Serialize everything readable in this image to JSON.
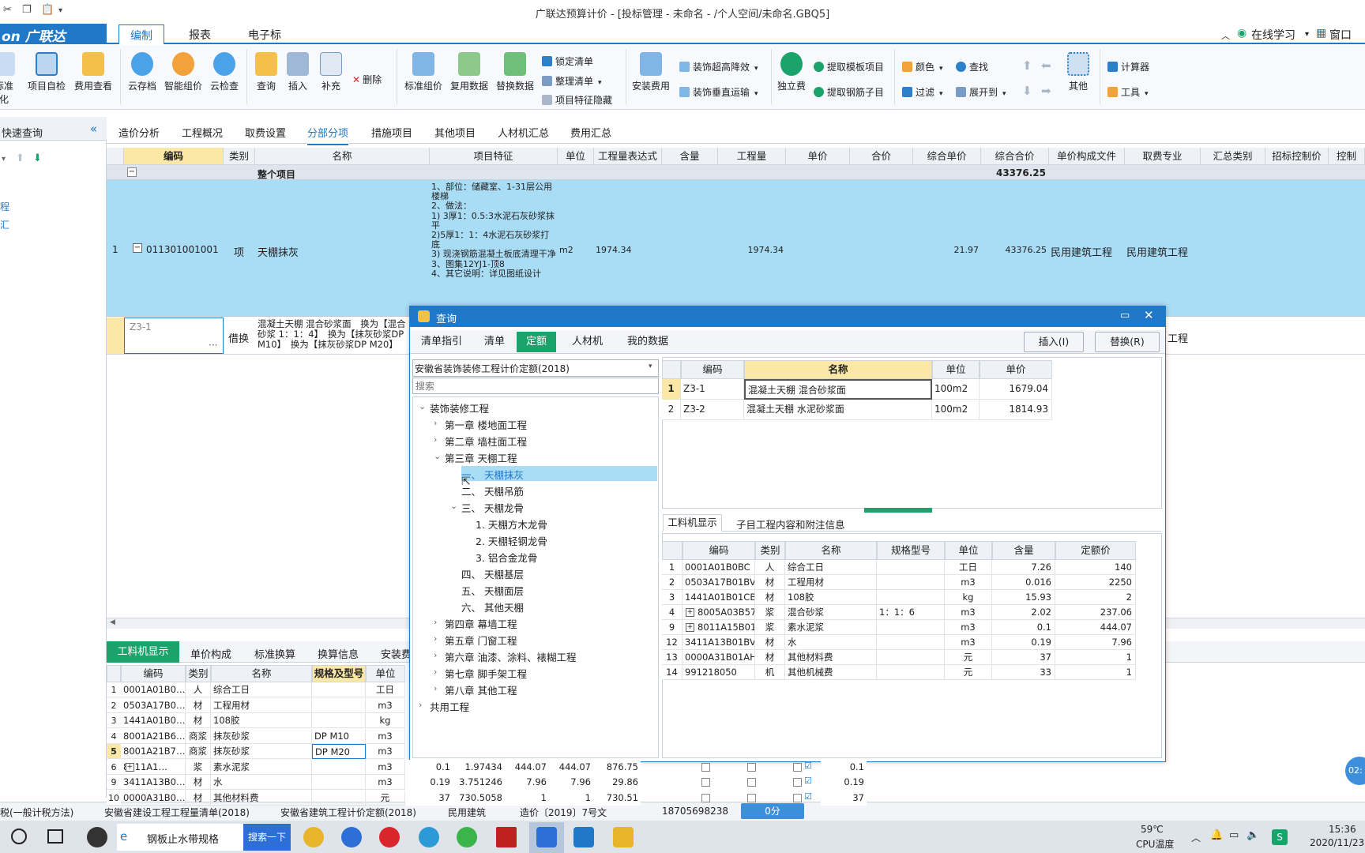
{
  "window_title": "广联达预算计价 - [投标管理 - 未命名 - /个人空间/未命名.GBQ5]",
  "logo_text": "on 广联达",
  "menu": {
    "tabs": [
      "编制",
      "报表",
      "电子标"
    ],
    "right": [
      "在线学习",
      "窗口"
    ]
  },
  "ribbon": {
    "big_buttons": [
      "标准化",
      "项目自检",
      "费用查看",
      "云存档",
      "智能组价",
      "云检查",
      "查询",
      "插入",
      "补充",
      "标准组价",
      "复用数据",
      "替换数据",
      "安装费用",
      "独立费",
      "其他"
    ],
    "small_buttons": [
      "删除",
      "锁定清单",
      "整理清单",
      "项目特征隐藏",
      "装饰超高降效",
      "装饰垂直运输",
      "提取模板项目",
      "提取钢筋子目",
      "颜色",
      "查找",
      "过滤",
      "展开到",
      "计算器",
      "工具"
    ]
  },
  "left_panel": {
    "title": "快速查询",
    "items": [
      "程",
      "汇"
    ]
  },
  "view_tabs": [
    "造价分析",
    "工程概况",
    "取费设置",
    "分部分项",
    "措施项目",
    "其他项目",
    "人材机汇总",
    "费用汇总"
  ],
  "grid": {
    "headers": [
      "编码",
      "类别",
      "名称",
      "项目特征",
      "单位",
      "工程量表达式",
      "含量",
      "工程量",
      "单价",
      "合价",
      "综合单价",
      "综合合价",
      "单价构成文件",
      "取费专业",
      "汇总类别",
      "招标控制价",
      "控制"
    ],
    "total_row": {
      "label": "整个项目",
      "amount": "43376.25"
    },
    "row1": {
      "index": "1",
      "code": "011301001001",
      "type": "项",
      "name": "天棚抹灰",
      "feature": "1、部位：储藏室、1-31层公用楼梯\n2、做法：\n1) 3厚1：0.5:3水泥石灰砂浆抹平\n2)5厚1：1：4水泥石灰砂浆打底\n3) 现浇钢筋混凝土板底清理干净\n3、图集12YJ1-顶8\n4、其它说明：详见图纸设计",
      "unit": "m2",
      "qty_expr": "1974.34",
      "qty": "1974.34",
      "unit_price": "21.97",
      "total": "43376.25",
      "price_file": "民用建筑工程",
      "fee_major": "民用建筑工程"
    },
    "row2": {
      "code": "Z3-1",
      "type": "借换",
      "name": "混凝土天棚 混合砂浆面　换为【混合砂浆 1：1：4】　换为【抹灰砂浆DP M10】　换为【抹灰砂浆DP M20】",
      "fee_major_partial": "工程"
    }
  },
  "bottom_panel": {
    "tabs": [
      "工料机显示",
      "单价构成",
      "标准换算",
      "换算信息",
      "安装费"
    ],
    "headers": [
      "编码",
      "类别",
      "名称",
      "规格及型号",
      "单位"
    ],
    "rows": [
      {
        "i": "1",
        "code": "0001A01B0…",
        "type": "人",
        "name": "综合工日",
        "spec": "",
        "unit": "工日",
        "extra": []
      },
      {
        "i": "2",
        "code": "0503A17B0…",
        "type": "材",
        "name": "工程用材",
        "spec": "",
        "unit": "m3",
        "extra": []
      },
      {
        "i": "3",
        "code": "1441A01B0…",
        "type": "材",
        "name": "108胶",
        "spec": "",
        "unit": "kg",
        "extra": []
      },
      {
        "i": "4",
        "code": "8001A21B6…",
        "type": "商浆",
        "name": "抹灰砂浆",
        "spec": "DP M10",
        "unit": "m3",
        "extra": []
      },
      {
        "i": "5",
        "code": "8001A21B7…",
        "type": "商浆",
        "name": "抹灰砂浆",
        "spec": "DP M20",
        "unit": "m3",
        "extra": []
      },
      {
        "i": "6",
        "code": "8011A1…",
        "type": "浆",
        "name": "素水泥浆",
        "spec": "",
        "unit": "m3",
        "extra": [
          "0.1",
          "1.97434",
          "444.07",
          "444.07",
          "876.75",
          "0.1"
        ]
      },
      {
        "i": "9",
        "code": "3411A13B0…",
        "type": "材",
        "name": "水",
        "spec": "",
        "unit": "m3",
        "extra": [
          "0.19",
          "3.751246",
          "7.96",
          "7.96",
          "29.86",
          "0.19"
        ]
      },
      {
        "i": "10",
        "code": "0000A31B0…",
        "type": "材",
        "name": "其他材料费",
        "spec": "",
        "unit": "元",
        "extra": [
          "37",
          "730.5058",
          "1",
          "1",
          "730.51",
          "37"
        ]
      }
    ]
  },
  "dialog": {
    "title": "查询",
    "tabs": [
      "清单指引",
      "清单",
      "定额",
      "人材机",
      "我的数据"
    ],
    "buttons": [
      "插入(I)",
      "替换(R)"
    ],
    "library": "安徽省装饰装修工程计价定额(2018)",
    "search_placeholder": "搜索",
    "tree": [
      {
        "label": "装饰装修工程",
        "level": 0,
        "arrow": "down"
      },
      {
        "label": "第一章 楼地面工程",
        "level": 1,
        "arrow": "right"
      },
      {
        "label": "第二章 墙柱面工程",
        "level": 1,
        "arrow": "right"
      },
      {
        "label": "第三章 天棚工程",
        "level": 1,
        "arrow": "down"
      },
      {
        "label": "一、 天棚抹灰",
        "level": 2,
        "arrow": "",
        "selected": true
      },
      {
        "label": "二、 天棚吊筋",
        "level": 2,
        "arrow": ""
      },
      {
        "label": "三、 天棚龙骨",
        "level": 2,
        "arrow": "down"
      },
      {
        "label": "1. 天棚方木龙骨",
        "level": 3,
        "arrow": ""
      },
      {
        "label": "2. 天棚轻钢龙骨",
        "level": 3,
        "arrow": ""
      },
      {
        "label": "3. 铝合金龙骨",
        "level": 3,
        "arrow": ""
      },
      {
        "label": "四、 天棚基层",
        "level": 2,
        "arrow": ""
      },
      {
        "label": "五、 天棚面层",
        "level": 2,
        "arrow": ""
      },
      {
        "label": "六、 其他天棚",
        "level": 2,
        "arrow": ""
      },
      {
        "label": "第四章 幕墙工程",
        "level": 1,
        "arrow": "right"
      },
      {
        "label": "第五章 门窗工程",
        "level": 1,
        "arrow": "right"
      },
      {
        "label": "第六章 油漆、涂料、裱糊工程",
        "level": 1,
        "arrow": "right"
      },
      {
        "label": "第七章 脚手架工程",
        "level": 1,
        "arrow": "right"
      },
      {
        "label": "第八章 其他工程",
        "level": 1,
        "arrow": "right"
      },
      {
        "label": "共用工程",
        "level": 0,
        "arrow": "right"
      }
    ],
    "quota_headers": [
      "编码",
      "名称",
      "单位",
      "单价"
    ],
    "quota_rows": [
      {
        "i": "1",
        "code": "Z3-1",
        "name": "混凝土天棚 混合砂浆面",
        "unit": "100m2",
        "price": "1679.04"
      },
      {
        "i": "2",
        "code": "Z3-2",
        "name": "混凝土天棚 水泥砂浆面",
        "unit": "100m2",
        "price": "1814.93"
      }
    ],
    "sub_tabs": [
      "工料机显示",
      "子目工程内容和附注信息"
    ],
    "mat_headers": [
      "编码",
      "类别",
      "名称",
      "规格型号",
      "单位",
      "含量",
      "定额价"
    ],
    "mat_rows": [
      {
        "i": "1",
        "code": "0001A01B0BC",
        "type": "人",
        "name": "综合工日",
        "spec": "",
        "unit": "工日",
        "qty": "7.26",
        "price": "140",
        "expand": false
      },
      {
        "i": "2",
        "code": "0503A17B01BV",
        "type": "材",
        "name": "工程用材",
        "spec": "",
        "unit": "m3",
        "qty": "0.016",
        "price": "2250",
        "expand": false
      },
      {
        "i": "3",
        "code": "1441A01B01CB",
        "type": "材",
        "name": "108胶",
        "spec": "",
        "unit": "kg",
        "qty": "15.93",
        "price": "2",
        "expand": false
      },
      {
        "i": "4",
        "code": "8005A03B57BV",
        "type": "浆",
        "name": "混合砂浆",
        "spec": "1：1：6",
        "unit": "m3",
        "qty": "2.02",
        "price": "237.06",
        "expand": true
      },
      {
        "i": "9",
        "code": "8011A15B01BV",
        "type": "浆",
        "name": "素水泥浆",
        "spec": "",
        "unit": "m3",
        "qty": "0.1",
        "price": "444.07",
        "expand": true
      },
      {
        "i": "12",
        "code": "3411A13B01BV",
        "type": "材",
        "name": "水",
        "spec": "",
        "unit": "m3",
        "qty": "0.19",
        "price": "7.96",
        "expand": false
      },
      {
        "i": "13",
        "code": "0000A31B01AH",
        "type": "材",
        "name": "其他材料费",
        "spec": "",
        "unit": "元",
        "qty": "37",
        "price": "1",
        "expand": false
      },
      {
        "i": "14",
        "code": "991218050",
        "type": "机",
        "name": "其他机械费",
        "spec": "",
        "unit": "元",
        "qty": "33",
        "price": "1",
        "expand": false
      }
    ]
  },
  "status_bar": [
    "税(一般计税方法)",
    "安徽省建设工程工程量清单(2018)",
    "安徽省建筑工程计价定额(2018)",
    "民用建筑",
    "造价〔2019〕7号文",
    "18705698238",
    "0分"
  ],
  "floating_badge": "02:",
  "taskbar": {
    "browser_label": "钢板止水带规格",
    "search_button": "搜索一下",
    "temperature": "59℃",
    "temp_label": "CPU温度",
    "time": "15:36",
    "date": "2020/11/23"
  },
  "colors": {
    "accent": "#1f78c8",
    "selected_row": "#a9dcf5",
    "dialog_tab_active": "#1aa36a"
  }
}
